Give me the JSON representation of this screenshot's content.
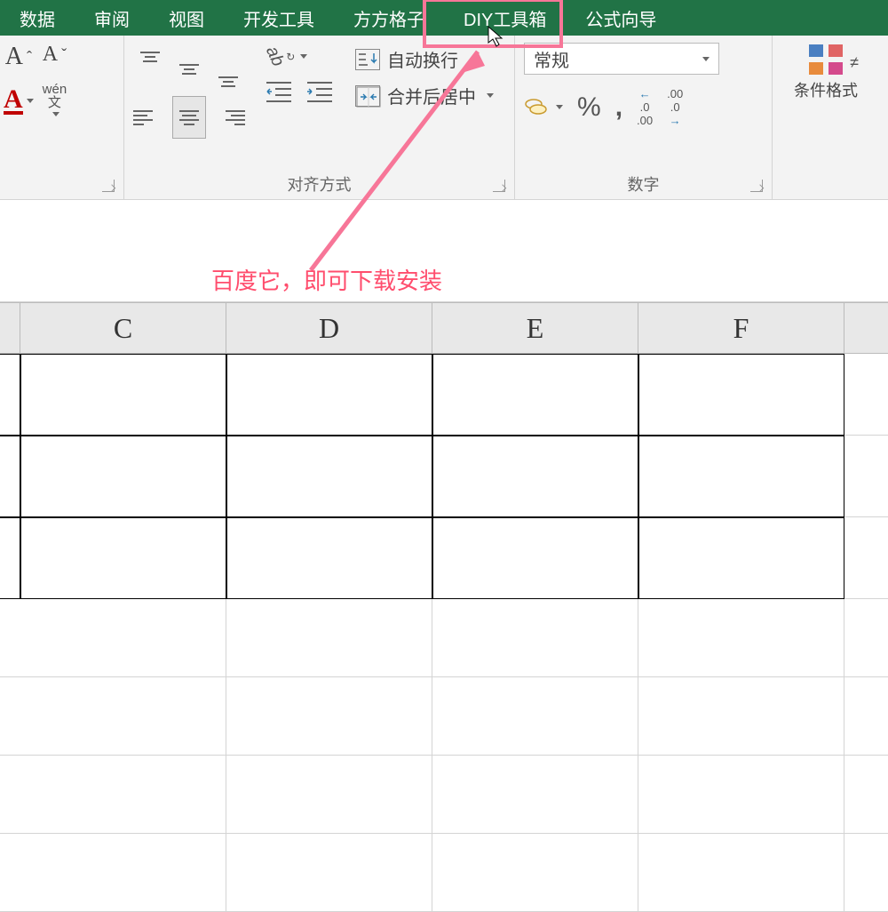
{
  "tabs": {
    "data": "数据",
    "review": "审阅",
    "view": "视图",
    "developer": "开发工具",
    "fangfang": "方方格子",
    "diytools": "DIY工具箱",
    "formulawiz": "公式向导"
  },
  "ribbon": {
    "align_group_label": "对齐方式",
    "number_group_label": "数字",
    "wen_label_top": "wén",
    "wen_label_bottom": "文",
    "wrap_text": "自动换行",
    "merge_center": "合并后居中",
    "number_format": "常规",
    "dec_increase_top": ".0",
    "dec_increase_bottom": ".00",
    "dec_decrease_top": ".00",
    "dec_decrease_bottom": ".0",
    "percent": "%",
    "comma": ",",
    "conditional_format": "条件格式"
  },
  "columns": [
    "C",
    "D",
    "E",
    "F"
  ],
  "annotation_text": "百度它，即可下载安装"
}
